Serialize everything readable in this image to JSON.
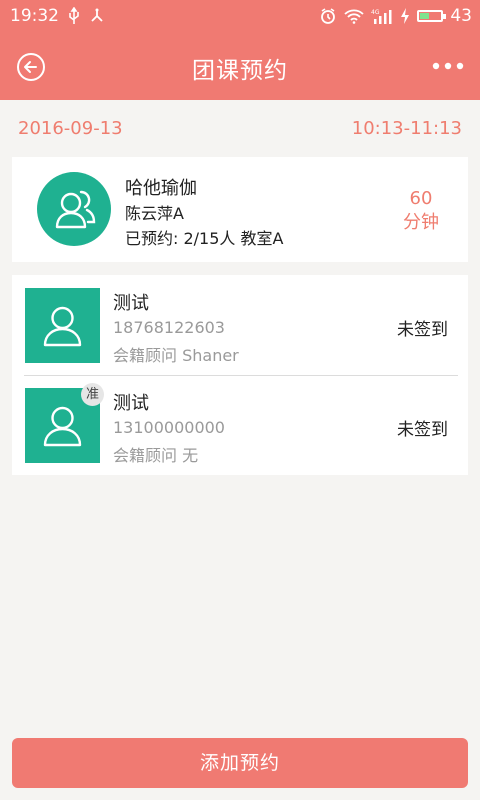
{
  "status_bar": {
    "time": "19:32",
    "battery_level": "43",
    "network": "4G"
  },
  "header": {
    "title": "团课预约"
  },
  "session": {
    "date": "2016-09-13",
    "time_range": "10:13-11:13"
  },
  "course": {
    "name": "哈他瑜伽",
    "coach": "陈云萍A",
    "booked": "已预约: 2/15人   教室A",
    "duration_value": "60",
    "duration_unit": "分钟"
  },
  "members": [
    {
      "name": "测试",
      "phone": "18768122603",
      "advisor": "会籍顾问 Shaner",
      "status": "未签到"
    },
    {
      "name": "测试",
      "phone": "13100000000",
      "advisor": "会籍顾问 无",
      "status": "未签到",
      "badge": "准"
    }
  ],
  "actions": {
    "add_booking": "添加预约"
  },
  "colors": {
    "brand": "#f07a72",
    "accent_green": "#1fb191",
    "date_text": "#ef7d6f"
  }
}
